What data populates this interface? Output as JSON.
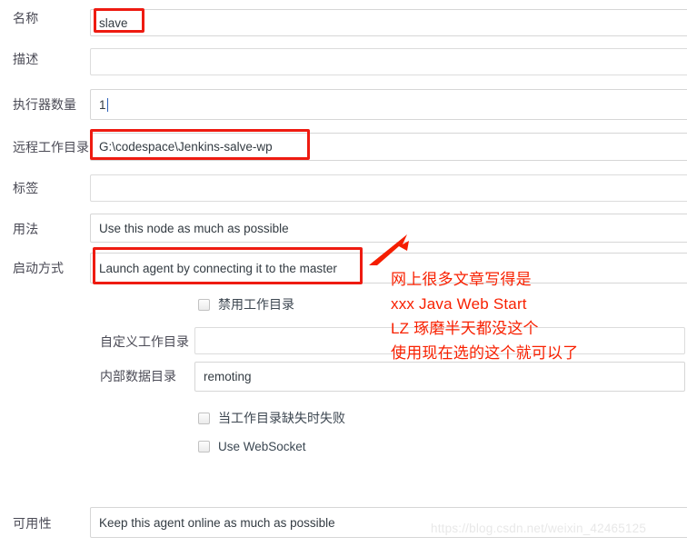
{
  "form": {
    "rows": [
      {
        "label": "名称",
        "value": "slave",
        "placeholder": ""
      },
      {
        "label": "描述",
        "value": "",
        "placeholder": ""
      },
      {
        "label": "执行器数量",
        "value": "1",
        "placeholder": ""
      },
      {
        "label": "远程工作目录",
        "value": "G:\\codespace\\Jenkins-salve-wp",
        "placeholder": ""
      },
      {
        "label": "标签",
        "value": "",
        "placeholder": ""
      },
      {
        "label": "用法",
        "value": "Use this node as much as possible",
        "placeholder": ""
      },
      {
        "label": "启动方式",
        "value": "Launch agent by connecting it to the master",
        "placeholder": ""
      }
    ],
    "launch_options": {
      "disable_workdir": {
        "label": "禁用工作目录",
        "checked": false
      },
      "custom_workdir": {
        "label": "自定义工作目录",
        "value": "",
        "placeholder": ""
      },
      "internal_data_dir": {
        "label": "内部数据目录",
        "value": "remoting",
        "placeholder": ""
      },
      "fail_if_workdir_missing": {
        "label": "当工作目录缺失时失败",
        "checked": false
      },
      "use_websocket": {
        "label": "Use WebSocket",
        "checked": false
      }
    },
    "availability": {
      "label": "可用性",
      "value": "Keep this agent online as much as possible"
    }
  },
  "annotation": {
    "color": "#f82000",
    "lines": [
      "网上很多文章写得是",
      "xxx Java Web Start",
      "LZ 琢磨半天都没这个",
      "使用现在选的这个就可以了"
    ],
    "arrow_name": "red-arrow-pointing-to-launch-method"
  },
  "watermark": {
    "text": "https://blog.csdn.net/weixin_42465125"
  }
}
